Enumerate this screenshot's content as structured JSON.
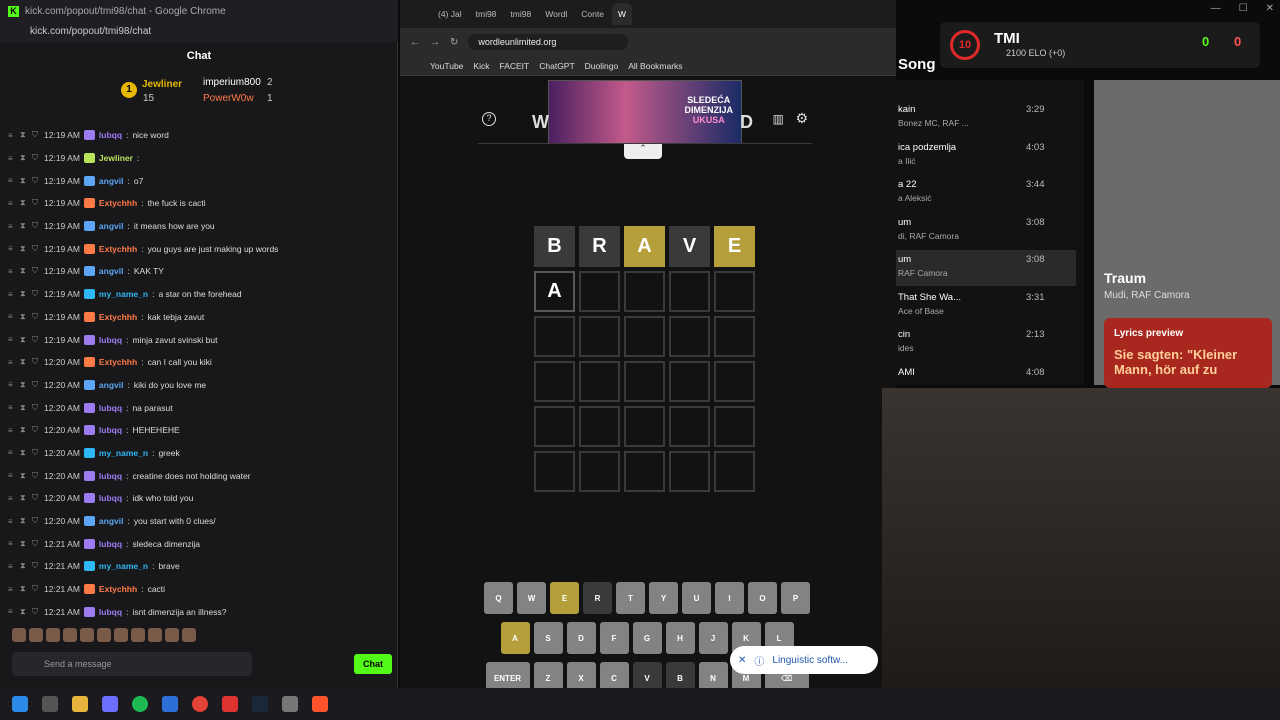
{
  "chat_window": {
    "title": "kick.com/popout/tmi98/chat - Google Chrome",
    "url": "kick.com/popout/tmi98/chat",
    "header": "Chat"
  },
  "leaderboard": [
    {
      "rank": "1",
      "name": "Jewliner",
      "count": "15"
    },
    {
      "name": "imperium800",
      "count": "2"
    },
    {
      "name": "PowerW0w",
      "count": "1"
    }
  ],
  "messages": [
    {
      "time": "12:19 AM",
      "user": "lubqq",
      "text": "nice word",
      "color": "#9d7cf2"
    },
    {
      "time": "12:19 AM",
      "user": "Jewliner",
      "text": "",
      "color": "#b8e25a"
    },
    {
      "time": "12:19 AM",
      "user": "angvil",
      "text": "o7",
      "color": "#5ca6f5"
    },
    {
      "time": "12:19 AM",
      "user": "Extychhh",
      "text": "the fuck is cacti",
      "color": "#ff7a45"
    },
    {
      "time": "12:19 AM",
      "user": "angvil",
      "text": "it means how are you",
      "color": "#5ca6f5"
    },
    {
      "time": "12:19 AM",
      "user": "Extychhh",
      "text": "you guys are just making up words",
      "color": "#ff7a45"
    },
    {
      "time": "12:19 AM",
      "user": "angvil",
      "text": "KAK TY",
      "color": "#5ca6f5"
    },
    {
      "time": "12:19 AM",
      "user": "my_name_n",
      "text": "a star on the forehead",
      "color": "#2fb7f5"
    },
    {
      "time": "12:19 AM",
      "user": "Extychhh",
      "text": "kak tebja zavut",
      "color": "#ff7a45"
    },
    {
      "time": "12:19 AM",
      "user": "lubqq",
      "text": "minja zavut svinski but",
      "color": "#9d7cf2"
    },
    {
      "time": "12:20 AM",
      "user": "Extychhh",
      "text": "can I call you kiki",
      "color": "#ff7a45"
    },
    {
      "time": "12:20 AM",
      "user": "angvil",
      "text": "kiki do you love me",
      "color": "#5ca6f5"
    },
    {
      "time": "12:20 AM",
      "user": "lubqq",
      "text": "na parasut",
      "color": "#9d7cf2"
    },
    {
      "time": "12:20 AM",
      "user": "lubqq",
      "text": "HEHEHEHE",
      "color": "#9d7cf2"
    },
    {
      "time": "12:20 AM",
      "user": "my_name_n",
      "text": "greek",
      "color": "#2fb7f5"
    },
    {
      "time": "12:20 AM",
      "user": "lubqq",
      "text": "creatine does not holding water",
      "color": "#9d7cf2"
    },
    {
      "time": "12:20 AM",
      "user": "lubqq",
      "text": "idk who told you",
      "color": "#9d7cf2"
    },
    {
      "time": "12:20 AM",
      "user": "angvil",
      "text": "you start with 0 clues/",
      "color": "#5ca6f5"
    },
    {
      "time": "12:21 AM",
      "user": "lubqq",
      "text": "sledeca dimenzija",
      "color": "#9d7cf2"
    },
    {
      "time": "12:21 AM",
      "user": "my_name_n",
      "text": "brave",
      "color": "#2fb7f5"
    },
    {
      "time": "12:21 AM",
      "user": "Extychhh",
      "text": "cacti",
      "color": "#ff7a45"
    },
    {
      "time": "12:21 AM",
      "user": "lubqq",
      "text": "isnt dimenzija an illness?",
      "color": "#9d7cf2"
    }
  ],
  "chat_input": {
    "placeholder": "Send a message",
    "send_label": "Chat"
  },
  "browser": {
    "tabs": [
      "(4) Jal",
      "tmi98",
      "tmi98",
      "Wordl",
      "Conte",
      "W"
    ],
    "url": "wordleunlimited.org",
    "bookmarks": [
      "YouTube",
      "Kick",
      "FACEIT",
      "ChatGPT",
      "Duolingo",
      "All Bookmarks"
    ]
  },
  "ad": {
    "line1": "SLEDEĆA",
    "line2": "DIMENZIJA",
    "line3": "UKUSA"
  },
  "wordle": {
    "title_left": "W",
    "title_right": "D",
    "rows": [
      [
        {
          "l": "B",
          "s": "absent"
        },
        {
          "l": "R",
          "s": "absent"
        },
        {
          "l": "A",
          "s": "present"
        },
        {
          "l": "V",
          "s": "absent"
        },
        {
          "l": "E",
          "s": "present"
        }
      ],
      [
        {
          "l": "A",
          "s": "filled"
        },
        {
          "l": "",
          "s": ""
        },
        {
          "l": "",
          "s": ""
        },
        {
          "l": "",
          "s": ""
        },
        {
          "l": "",
          "s": ""
        }
      ],
      [
        {
          "l": "",
          "s": ""
        },
        {
          "l": "",
          "s": ""
        },
        {
          "l": "",
          "s": ""
        },
        {
          "l": "",
          "s": ""
        },
        {
          "l": "",
          "s": ""
        }
      ],
      [
        {
          "l": "",
          "s": ""
        },
        {
          "l": "",
          "s": ""
        },
        {
          "l": "",
          "s": ""
        },
        {
          "l": "",
          "s": ""
        },
        {
          "l": "",
          "s": ""
        }
      ],
      [
        {
          "l": "",
          "s": ""
        },
        {
          "l": "",
          "s": ""
        },
        {
          "l": "",
          "s": ""
        },
        {
          "l": "",
          "s": ""
        },
        {
          "l": "",
          "s": ""
        }
      ],
      [
        {
          "l": "",
          "s": ""
        },
        {
          "l": "",
          "s": ""
        },
        {
          "l": "",
          "s": ""
        },
        {
          "l": "",
          "s": ""
        },
        {
          "l": "",
          "s": ""
        }
      ]
    ],
    "keys_row1": [
      {
        "k": "Q"
      },
      {
        "k": "W"
      },
      {
        "k": "E",
        "s": "present"
      },
      {
        "k": "R",
        "s": "absent"
      },
      {
        "k": "T"
      },
      {
        "k": "Y"
      },
      {
        "k": "U"
      },
      {
        "k": "I"
      },
      {
        "k": "O"
      },
      {
        "k": "P"
      }
    ],
    "keys_row2": [
      {
        "k": "A",
        "s": "present"
      },
      {
        "k": "S"
      },
      {
        "k": "D"
      },
      {
        "k": "F"
      },
      {
        "k": "G"
      },
      {
        "k": "H"
      },
      {
        "k": "J"
      },
      {
        "k": "K"
      },
      {
        "k": "L"
      }
    ],
    "keys_row3": [
      {
        "k": "ENTER",
        "w": 1
      },
      {
        "k": "Z"
      },
      {
        "k": "X"
      },
      {
        "k": "C"
      },
      {
        "k": "V",
        "s": "absent"
      },
      {
        "k": "B",
        "s": "absent"
      },
      {
        "k": "N"
      },
      {
        "k": "M"
      },
      {
        "k": "⌫",
        "w": 1
      }
    ]
  },
  "toast": "Linguistic softw...",
  "spotify": {
    "header": "Song",
    "songs": [
      {
        "name": "kain",
        "artist": "Bonez MC, RAF ...",
        "dur": "3:29"
      },
      {
        "name": "ica podzemlja",
        "artist": "a Ilić",
        "dur": "4:03"
      },
      {
        "name": "a 22",
        "artist": "a Aleksić",
        "dur": "3:44"
      },
      {
        "name": "um",
        "artist": "di, RAF Camora",
        "dur": "3:08"
      },
      {
        "name": "um",
        "artist": "RAF Camora",
        "dur": "3:08",
        "active": true
      },
      {
        "name": "That She Wa...",
        "artist": "Ace of Base",
        "dur": "3:31"
      },
      {
        "name": "cin",
        "artist": "ides",
        "dur": "2:13"
      },
      {
        "name": "AMI",
        "artist": "",
        "dur": "4:08"
      }
    ],
    "now_title": "Traum",
    "now_artist": "Mudi, RAF Camora",
    "lyrics_header": "Lyrics preview",
    "lyrics_text": "Sie sagten: \"Kleiner Mann, hör auf zu"
  },
  "elo": {
    "level": "10",
    "name": "TMI",
    "elo": "2100 ELO (+0)",
    "wins": "0",
    "losses": "0"
  }
}
